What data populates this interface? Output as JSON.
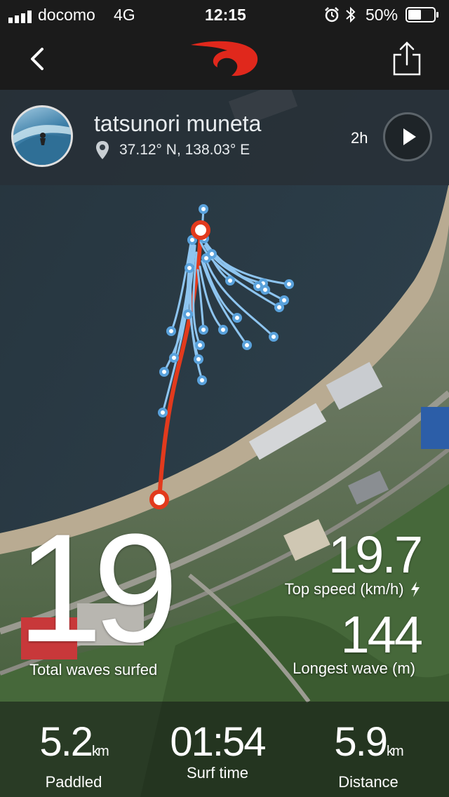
{
  "status_bar": {
    "carrier": "docomo",
    "network": "4G",
    "time": "12:15",
    "battery": "50%",
    "battery_level": 0.5
  },
  "nav": {
    "back_icon": "chevron-left-icon",
    "logo": "rip-curl-logo",
    "share_icon": "share-icon"
  },
  "profile": {
    "name": "tatsunori muneta",
    "location": "37.12° N, 138.03° E",
    "duration": "2h"
  },
  "stats": {
    "total_waves_value": "19",
    "total_waves_label": "Total waves surfed",
    "top_speed_value": "19.7",
    "top_speed_label": "Top speed (km/h)",
    "longest_wave_value": "144",
    "longest_wave_label": "Longest wave (m)"
  },
  "footer": {
    "paddled_value": "5.2",
    "paddled_unit": "km",
    "paddled_label": "Paddled",
    "surf_time_value": "01:54",
    "surf_time_label": "Surf time",
    "distance_value": "5.9",
    "distance_unit": "km",
    "distance_label": "Distance"
  },
  "colors": {
    "track_red": "#e23a1d",
    "wave_blue": "#8ec5f0",
    "brand_red": "#e0281c"
  }
}
